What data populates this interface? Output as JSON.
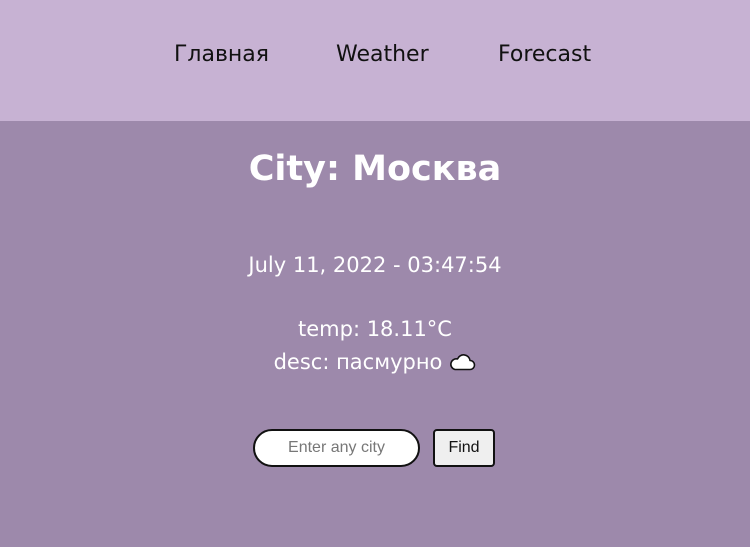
{
  "nav": {
    "items": [
      {
        "label": "Главная"
      },
      {
        "label": "Weather"
      },
      {
        "label": "Forecast"
      }
    ]
  },
  "weather": {
    "city_title": "City: Москва",
    "datetime": "July 11, 2022 - 03:47:54",
    "temp": "temp: 18.11°C",
    "desc": "desc: пасмурно",
    "desc_icon": "cloud-icon"
  },
  "search": {
    "placeholder": "Enter any city",
    "value": "",
    "button_label": "Find"
  },
  "colors": {
    "nav_background": "#c7b2d3",
    "page_background": "#9d89ab",
    "text_main": "#ffffff"
  }
}
